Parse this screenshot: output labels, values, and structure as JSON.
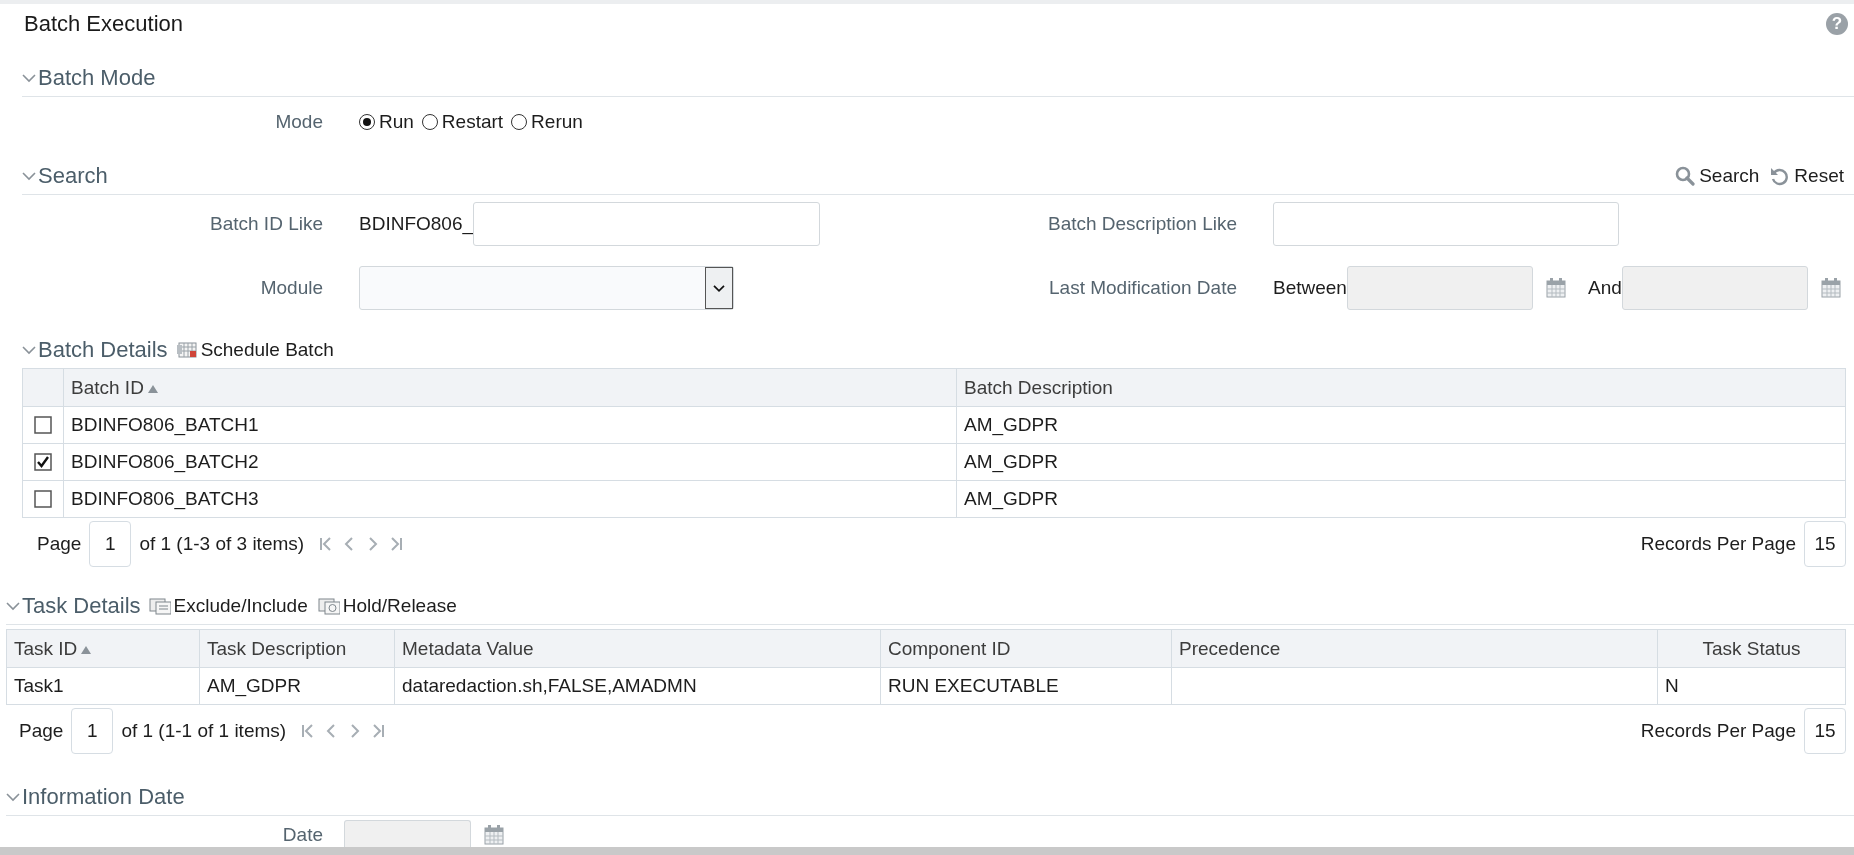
{
  "page": {
    "title": "Batch Execution",
    "help": "?"
  },
  "batch_mode": {
    "header": "Batch Mode",
    "label": "Mode",
    "options": [
      {
        "label": "Run",
        "selected": true
      },
      {
        "label": "Restart",
        "selected": false
      },
      {
        "label": "Rerun",
        "selected": false
      }
    ]
  },
  "search": {
    "header": "Search",
    "actions": [
      {
        "kind": "search",
        "label": "Search"
      },
      {
        "kind": "reset",
        "label": "Reset"
      }
    ],
    "batch_id_like": {
      "label": "Batch ID Like",
      "prefix": "BDINFO806_"
    },
    "batch_description_like": {
      "label": "Batch Description Like"
    },
    "module": {
      "label": "Module"
    },
    "last_modification_date": {
      "label": "Last Modification Date",
      "between": "Between",
      "and": "And"
    }
  },
  "batch_details": {
    "header": "Batch Details",
    "actions": [
      {
        "kind": "schedule",
        "label": "Schedule Batch"
      }
    ],
    "table": {
      "columns": [
        {
          "label": "Batch ID",
          "sorted": true
        },
        {
          "label": "Batch Description",
          "sorted": false
        }
      ],
      "rows": [
        {
          "checked": false,
          "cells": [
            "BDINFO806_BATCH1",
            "AM_GDPR"
          ]
        },
        {
          "checked": true,
          "cells": [
            "BDINFO806_BATCH2",
            "AM_GDPR"
          ]
        },
        {
          "checked": false,
          "cells": [
            "BDINFO806_BATCH3",
            "AM_GDPR"
          ]
        }
      ]
    },
    "pager": {
      "page_label": "Page",
      "page": "1",
      "summary": "of 1 (1-3 of 3 items)",
      "records_label": "Records Per Page",
      "records": "15"
    }
  },
  "task_details": {
    "header": "Task Details",
    "actions": [
      {
        "kind": "exclude",
        "label": "Exclude/Include"
      },
      {
        "kind": "hold",
        "label": "Hold/Release"
      }
    ],
    "table": {
      "columns": [
        {
          "label": "Task ID",
          "sorted": true
        },
        {
          "label": "Task Description",
          "sorted": false
        },
        {
          "label": "Metadata Value",
          "sorted": false
        },
        {
          "label": "Component ID",
          "sorted": false
        },
        {
          "label": "Precedence",
          "sorted": false
        },
        {
          "label": "Task Status",
          "sorted": false
        }
      ],
      "rows": [
        {
          "cells": [
            "Task1",
            "AM_GDPR",
            "dataredaction.sh,FALSE,AMADMN",
            "RUN EXECUTABLE",
            "",
            "N"
          ]
        }
      ]
    },
    "pager": {
      "page_label": "Page",
      "page": "1",
      "summary": "of 1 (1-1 of 1 items)",
      "records_label": "Records Per Page",
      "records": "15"
    }
  },
  "information_date": {
    "header": "Information Date",
    "label": "Date"
  }
}
